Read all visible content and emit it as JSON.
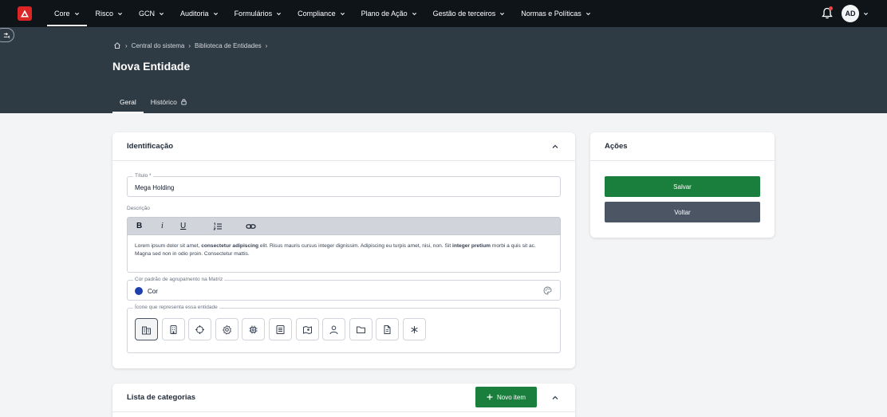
{
  "nav": {
    "logo": "app-logo",
    "items": [
      {
        "label": "Core",
        "active": true
      },
      {
        "label": "Risco"
      },
      {
        "label": "GCN"
      },
      {
        "label": "Auditoria"
      },
      {
        "label": "Formulários"
      },
      {
        "label": "Compliance"
      },
      {
        "label": "Plano de Ação"
      },
      {
        "label": "Gestão de terceiros"
      },
      {
        "label": "Normas e Políticas"
      }
    ],
    "avatar_initials": "AD"
  },
  "breadcrumb": {
    "items": [
      "Central do sistema",
      "Biblioteca de Entidades"
    ]
  },
  "page": {
    "title": "Nova Entidade",
    "tabs": [
      {
        "label": "Geral",
        "active": true
      },
      {
        "label": "Histórico",
        "locked": true
      }
    ]
  },
  "identificacao": {
    "title": "Identificação",
    "titulo_label": "Título *",
    "titulo_value": "Mega Holding",
    "descricao_label": "Descrição",
    "toolbar": {
      "bold": "B",
      "italic": "i",
      "underline": "U"
    },
    "descricao_parts": [
      {
        "text": "Lorem ipsum dolor sit amet, ",
        "bold": false
      },
      {
        "text": "consectetur adipiscing",
        "bold": true
      },
      {
        "text": " elit. Risus mauris cursus integer dignissim. Adipiscing eu turpis amet, nisi, non. Sit ",
        "bold": false
      },
      {
        "text": "integer pretium",
        "bold": true
      },
      {
        "text": " morbi a quis sit ac. Magna sed non in odio proin. Consectetur mattis.",
        "bold": false
      }
    ],
    "cor_label": "Cor padrão de agrupamento na Matriz",
    "cor_value": "Cor",
    "cor_color": "#1e40af",
    "icone_label": "Ícone que representa essa entidade",
    "icons": [
      "buildings-icon",
      "building-icon",
      "crosshair-icon",
      "gear-icon",
      "chip-icon",
      "list-icon",
      "map-icon",
      "user-icon",
      "folder-icon",
      "file-icon",
      "asterisk-icon"
    ],
    "selected_icon": "buildings-icon"
  },
  "acoes": {
    "title": "Ações",
    "save_label": "Salvar",
    "back_label": "Voltar"
  },
  "categorias": {
    "title": "Lista de categorias",
    "new_label": "Novo item"
  },
  "colors": {
    "primary_green": "#1a7f3c",
    "secondary_gray": "#4b5563",
    "header_bg": "#2f3b44",
    "nav_bg": "#0f1419"
  }
}
